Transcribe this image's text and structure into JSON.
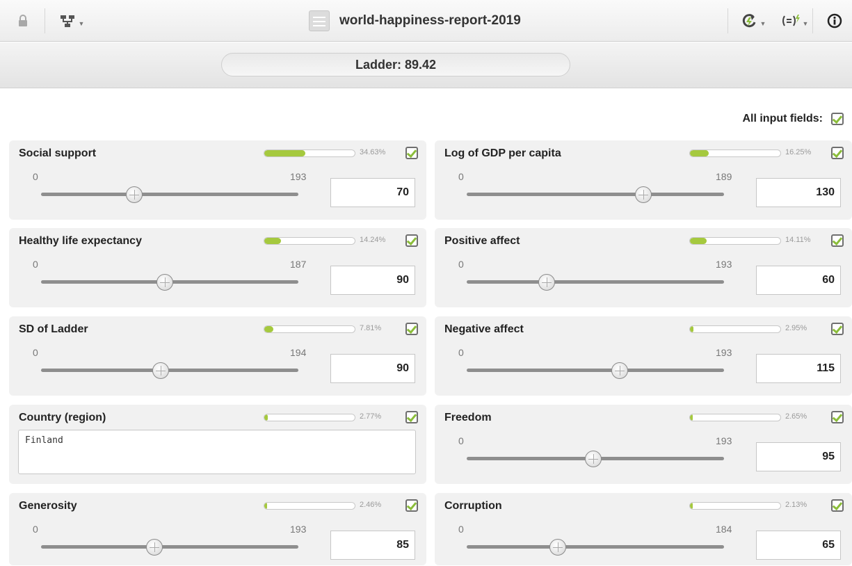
{
  "header": {
    "title": "world-happiness-report-2019",
    "icons": [
      "lock-icon",
      "tree-icon",
      "dataset-icon",
      "refresh-icon",
      "formula-icon",
      "info-icon"
    ]
  },
  "prediction": {
    "text": "Ladder: 89.42"
  },
  "all_fields": {
    "label": "All input fields:"
  },
  "fields": [
    {
      "label": "Social support",
      "importance": "34.63%",
      "importance_frac": 0.3463,
      "min": "0",
      "max": "193",
      "value": "70",
      "max_num": 193,
      "val_num": 70
    },
    {
      "label": "Log of GDP per capita",
      "importance": "16.25%",
      "importance_frac": 0.1625,
      "min": "0",
      "max": "189",
      "value": "130",
      "max_num": 189,
      "val_num": 130
    },
    {
      "label": "Healthy life expectancy",
      "importance": "14.24%",
      "importance_frac": 0.1424,
      "min": "0",
      "max": "187",
      "value": "90",
      "max_num": 187,
      "val_num": 90
    },
    {
      "label": "Positive affect",
      "importance": "14.11%",
      "importance_frac": 0.1411,
      "min": "0",
      "max": "193",
      "value": "60",
      "max_num": 193,
      "val_num": 60
    },
    {
      "label": "SD of Ladder",
      "importance": "7.81%",
      "importance_frac": 0.0781,
      "min": "0",
      "max": "194",
      "value": "90",
      "max_num": 194,
      "val_num": 90
    },
    {
      "label": "Negative affect",
      "importance": "2.95%",
      "importance_frac": 0.0295,
      "min": "0",
      "max": "193",
      "value": "115",
      "max_num": 193,
      "val_num": 115
    },
    {
      "label": "Country (region)",
      "importance": "2.77%",
      "importance_frac": 0.0277,
      "text_value": "Finland"
    },
    {
      "label": "Freedom",
      "importance": "2.65%",
      "importance_frac": 0.0265,
      "min": "0",
      "max": "193",
      "value": "95",
      "max_num": 193,
      "val_num": 95
    },
    {
      "label": "Generosity",
      "importance": "2.46%",
      "importance_frac": 0.0246,
      "min": "0",
      "max": "193",
      "value": "85",
      "max_num": 193,
      "val_num": 85
    },
    {
      "label": "Corruption",
      "importance": "2.13%",
      "importance_frac": 0.0213,
      "min": "0",
      "max": "184",
      "value": "65",
      "max_num": 184,
      "val_num": 65
    }
  ],
  "colors": {
    "accent": "#a5c93e",
    "panel": "#f1f1f1"
  }
}
